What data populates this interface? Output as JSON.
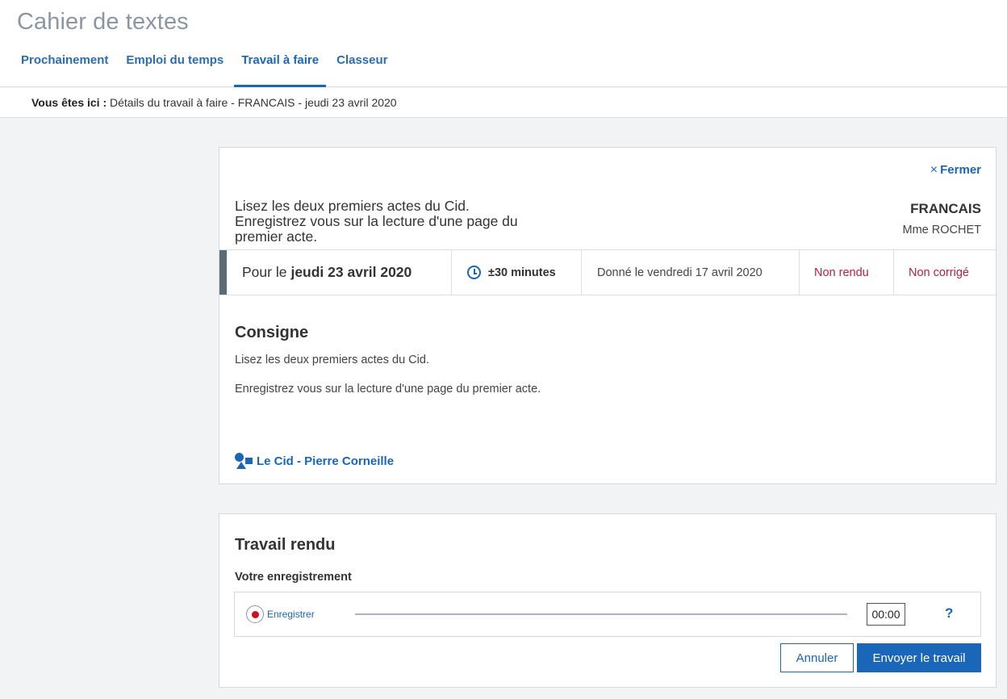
{
  "app": {
    "title": "Cahier de textes"
  },
  "tabs": [
    {
      "label": "Prochainement",
      "active": false
    },
    {
      "label": "Emploi du temps",
      "active": false
    },
    {
      "label": "Travail à faire",
      "active": true
    },
    {
      "label": "Classeur",
      "active": false
    }
  ],
  "breadcrumb": {
    "prefix": "Vous êtes ici :",
    "path": "Détails du travail à faire - FRANCAIS - jeudi 23 avril 2020"
  },
  "detail": {
    "close_label": "Fermer",
    "summary": "Lisez les deux premiers actes du Cid. Enregistrez vous sur la lecture d'une page du premier acte.",
    "subject": "FRANCAIS",
    "teacher": "Mme ROCHET",
    "due_prefix": "Pour le",
    "due_date": "jeudi 23 avril 2020",
    "duration": "±30 minutes",
    "given": "Donné le vendredi 17 avril 2020",
    "status_rendu": "Non rendu",
    "status_corrige": "Non corrigé",
    "consigne_title": "Consigne",
    "consigne_line1": "Lisez les deux premiers actes du Cid.",
    "consigne_line2": "Enregistrez vous sur la lecture d'une page du premier acte.",
    "resource_label": "Le Cid - Pierre Corneille"
  },
  "rendu": {
    "title": "Travail rendu",
    "subtitle": "Votre enregistrement",
    "record_label": "Enregistrer",
    "time": "00:00",
    "help": "?",
    "cancel_label": "Annuler",
    "send_label": "Envoyer le travail"
  },
  "colors": {
    "accent": "#1a66b9",
    "status_red": "#b0243e",
    "record_red": "#d20f1c"
  }
}
